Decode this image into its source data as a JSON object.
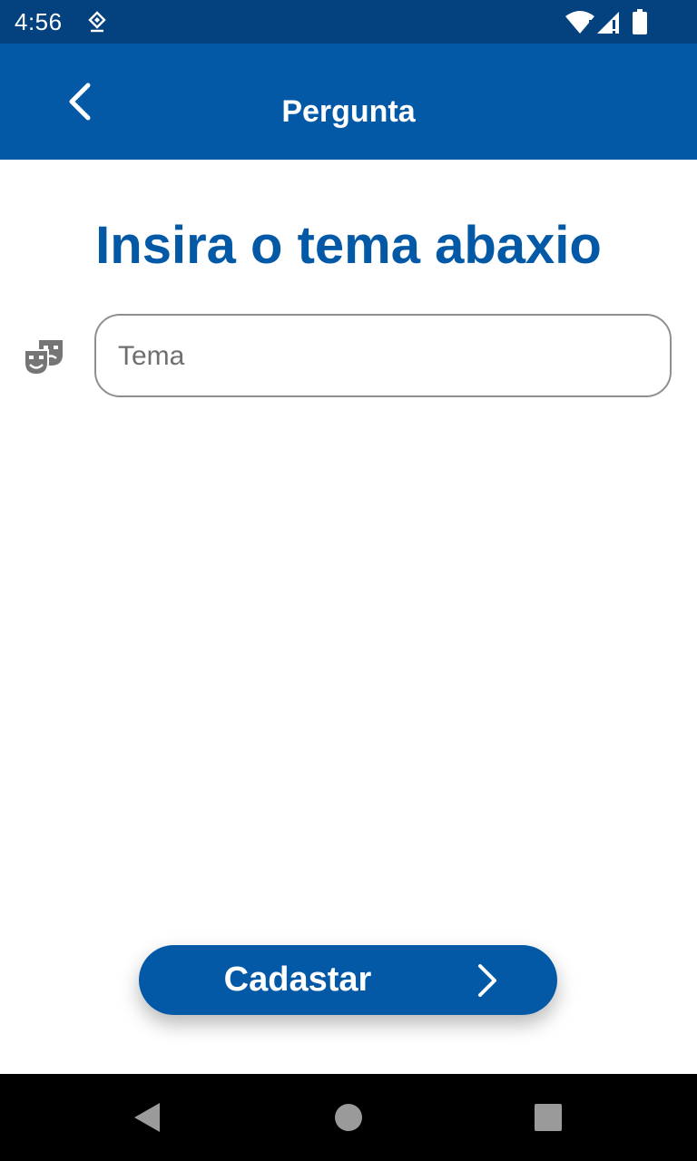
{
  "status_bar": {
    "time": "4:56",
    "notification_icon": "location-pin-icon",
    "wifi_icon": "wifi-icon",
    "signal_icon": "cell-signal-icon",
    "battery_icon": "battery-icon"
  },
  "app_bar": {
    "title": "Pergunta",
    "back_icon": "chevron-left-icon",
    "color": "#0359a6"
  },
  "main": {
    "heading": "Insira o tema abaxio",
    "theme_field": {
      "icon": "theater-masks-icon",
      "placeholder": "Tema",
      "value": ""
    },
    "submit_button": {
      "label": "Cadastar",
      "icon": "chevron-right-icon"
    }
  },
  "nav_bar": {
    "back": "nav-back-icon",
    "home": "nav-home-icon",
    "recents": "nav-recents-icon"
  },
  "colors": {
    "primary": "#0359a6",
    "status_bar": "#03427e",
    "icon_gray": "#757575",
    "border_gray": "#8f8f8f"
  }
}
